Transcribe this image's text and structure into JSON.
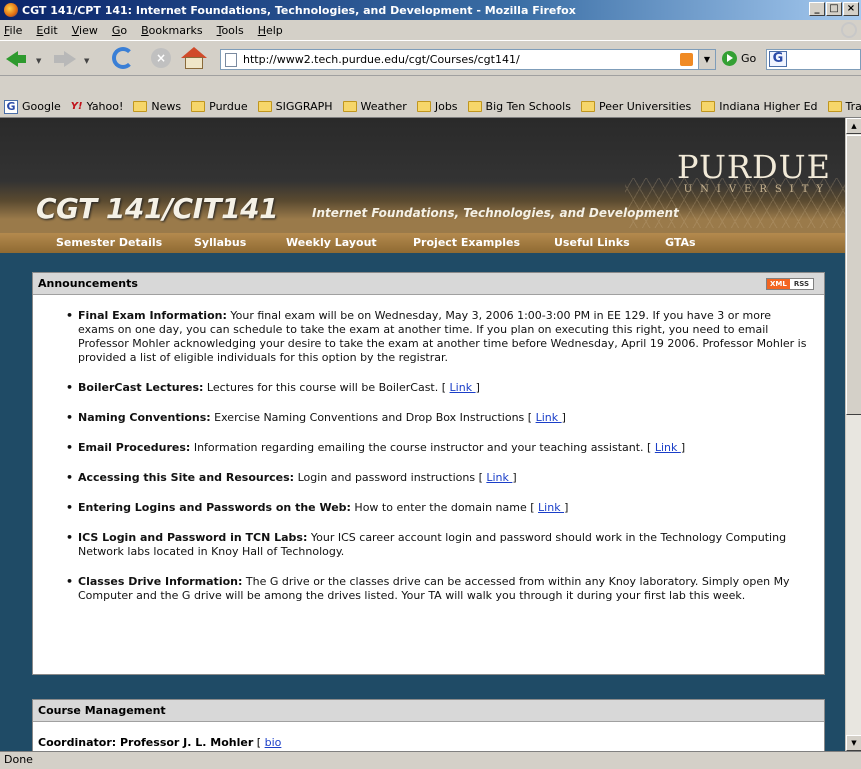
{
  "window": {
    "title": "CGT 141/CPT 141: Internet Foundations, Technologies, and Development - Mozilla Firefox",
    "min": "_",
    "max": "□",
    "close": "×"
  },
  "menu": [
    "File",
    "Edit",
    "View",
    "Go",
    "Bookmarks",
    "Tools",
    "Help"
  ],
  "nav": {
    "url": "http://www2.tech.purdue.edu/cgt/Courses/cgt141/",
    "go_label": "Go"
  },
  "bookmarks": [
    "Google",
    "Yahoo!",
    "News",
    "Purdue",
    "SIGGRAPH",
    "Weather",
    "Jobs",
    "Big Ten Schools",
    "Peer Universities",
    "Indiana Higher Ed",
    "Travel"
  ],
  "header": {
    "purdue": "PURDUE",
    "university": "UNIVERSITY",
    "course_code": "CGT 141/CIT141",
    "course_sub": "Internet Foundations, Technologies, and Development",
    "tabs": [
      "Semester Details",
      "Syllabus",
      "Weekly Layout",
      "Project Examples",
      "Useful Links",
      "GTAs"
    ]
  },
  "announcements": {
    "heading": "Announcements",
    "rss_x": "XML",
    "rss_r": "RSS",
    "items": [
      {
        "title": "Final Exam Information:",
        "body": " Your final exam will be on Wednesday, May 3, 2006 1:00-3:00 PM in EE 129. If you have 3 or more exams on one day, you can schedule to take the exam at another time. If you plan on executing this right, you need to email Professor Mohler acknowledging your desire to take the exam at another time before Wednesday, April 19 2006. Professor Mohler is provided a list of eligible individuals for this option by the registrar.",
        "pre": "",
        "link": "",
        "post": ""
      },
      {
        "title": "BoilerCast Lectures:",
        "body": " Lectures for this course will be BoilerCast.",
        "pre": " [ ",
        "link": "Link ",
        "post": "]"
      },
      {
        "title": "Naming Conventions:",
        "body": " Exercise Naming Conventions and Drop Box Instructions",
        "pre": " [ ",
        "link": "Link ",
        "post": "]"
      },
      {
        "title": "Email Procedures:",
        "body": " Information regarding emailing the course instructor and your teaching assistant.",
        "pre": " [ ",
        "link": "Link ",
        "post": "]"
      },
      {
        "title": "Accessing this Site and Resources:",
        "body": " Login and password instructions",
        "pre": " [ ",
        "link": "Link ",
        "post": "]"
      },
      {
        "title": "Entering Logins and Passwords on the Web:",
        "body": " How to enter the domain name",
        "pre": " [ ",
        "link": "Link ",
        "post": "]"
      },
      {
        "title": "ICS Login and Password in TCN Labs:",
        "body": " Your ICS career account login and password should work in the Technology Computing Network labs located in Knoy Hall of Technology.",
        "pre": "",
        "link": "",
        "post": ""
      },
      {
        "title": "Classes Drive Information:",
        "body": " The G drive or the classes drive can be accessed from within any Knoy laboratory. Simply open My Computer and the G drive will be among the drives listed. Your TA will walk you through it during your first lab this week.",
        "pre": "",
        "link": "",
        "post": ""
      }
    ]
  },
  "course_mgmt": {
    "heading": "Course Management",
    "coordinator": "Coordinator: Professor J. L. Mohler",
    "bio_pre": " [ ",
    "bio_link": "bio "
  },
  "status": "Done"
}
